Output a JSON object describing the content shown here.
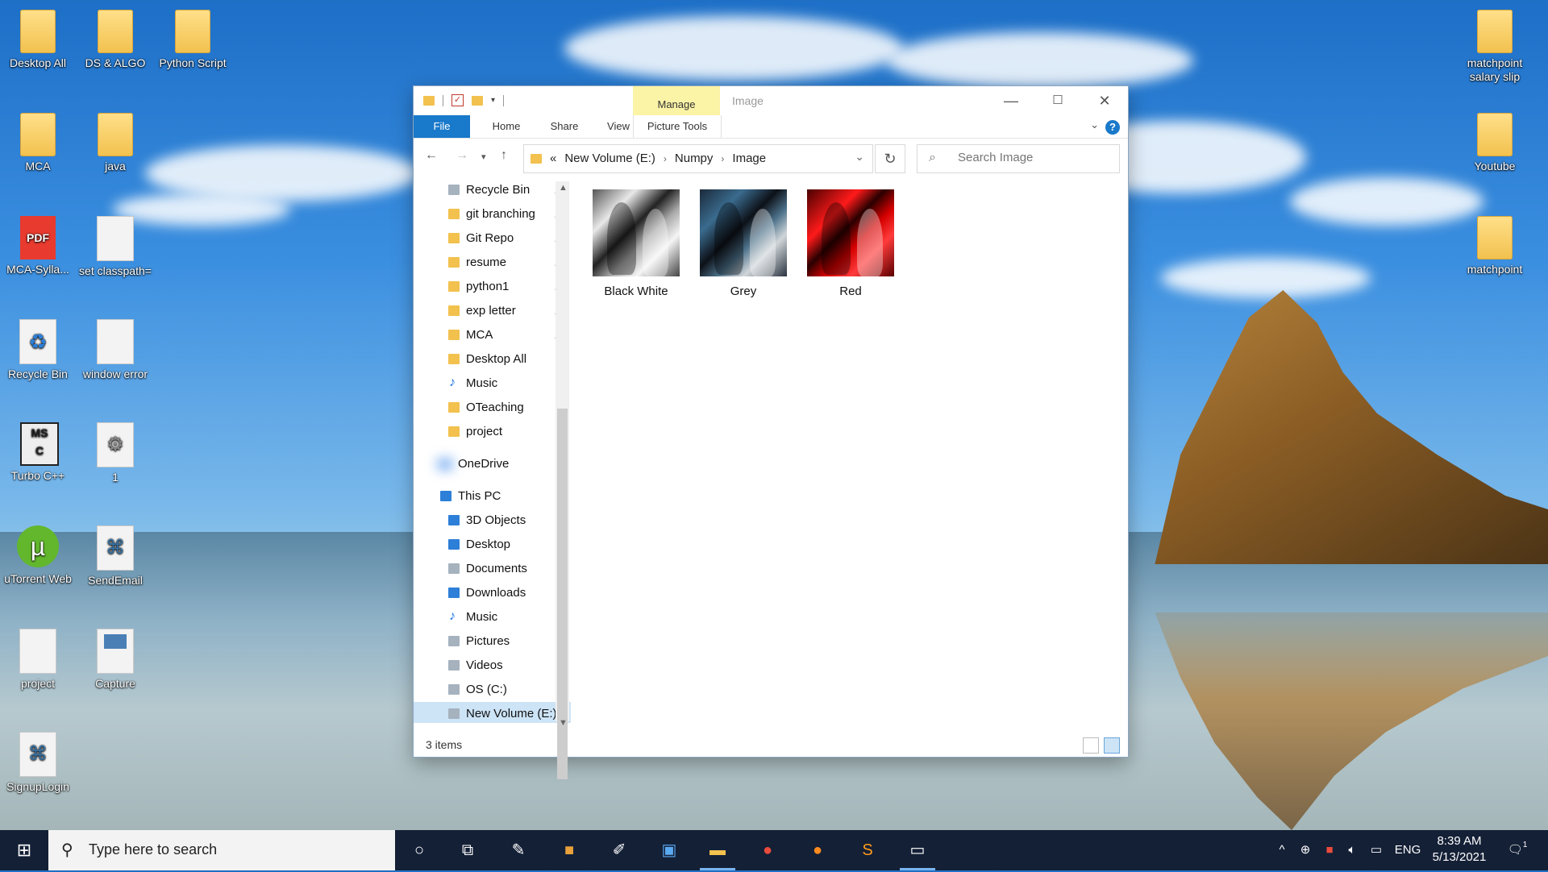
{
  "desktop": {
    "icons_left": [
      {
        "label": "Desktop All",
        "kind": "folder"
      },
      {
        "label": "DS & ALGO",
        "kind": "folder"
      },
      {
        "label": "Python Script",
        "kind": "folder"
      },
      {
        "label": "MCA",
        "kind": "folder"
      },
      {
        "label": "java",
        "kind": "folder"
      },
      {
        "label": "MCA-Sylla...",
        "kind": "pdf"
      },
      {
        "label": "set classpath=",
        "kind": "doc"
      },
      {
        "label": "Recycle Bin",
        "kind": "recycle"
      },
      {
        "label": "window error",
        "kind": "doc"
      },
      {
        "label": "Turbo C++",
        "kind": "app"
      },
      {
        "label": "1",
        "kind": "settings"
      },
      {
        "label": "uTorrent Web",
        "kind": "utorrent"
      },
      {
        "label": "SendEmail",
        "kind": "python"
      },
      {
        "label": "project",
        "kind": "doc"
      },
      {
        "label": "Capture",
        "kind": "image"
      },
      {
        "label": "SignupLogin",
        "kind": "python"
      }
    ],
    "icons_right": [
      {
        "label": "matchpoint salary slip",
        "kind": "folder"
      },
      {
        "label": "Youtube",
        "kind": "folder"
      },
      {
        "label": "matchpoint",
        "kind": "folder"
      }
    ],
    "pdf_badge": "PDF"
  },
  "explorer": {
    "title": "Image",
    "manage_tab": "Manage",
    "ribbon_tabs": [
      "File",
      "Home",
      "Share",
      "View",
      "Picture Tools"
    ],
    "breadcrumb": {
      "overflow": "«",
      "items": [
        "New Volume (E:)",
        "Numpy",
        "Image"
      ]
    },
    "search_placeholder": "Search Image",
    "nav": {
      "quick_access": [
        {
          "label": "Recycle Bin",
          "icon": "recycle-bin-icon",
          "pinned": true
        },
        {
          "label": "git branching",
          "icon": "folder-icon",
          "pinned": true
        },
        {
          "label": "Git Repo",
          "icon": "folder-icon",
          "pinned": true
        },
        {
          "label": "resume",
          "icon": "folder-icon",
          "pinned": true
        },
        {
          "label": "python1",
          "icon": "folder-icon",
          "pinned": true
        },
        {
          "label": "exp letter",
          "icon": "folder-icon",
          "pinned": true
        },
        {
          "label": "MCA",
          "icon": "folder-icon",
          "pinned": true
        },
        {
          "label": "Desktop All",
          "icon": "folder-icon",
          "pinned": false
        },
        {
          "label": "Music",
          "icon": "music-icon",
          "pinned": false
        },
        {
          "label": "OTeaching",
          "icon": "folder-icon",
          "pinned": false
        },
        {
          "label": "project",
          "icon": "folder-icon",
          "pinned": false
        }
      ],
      "onedrive": "OneDrive",
      "this_pc": "This PC",
      "pc_items": [
        {
          "label": "3D Objects",
          "icon": "3d-objects-icon"
        },
        {
          "label": "Desktop",
          "icon": "desktop-icon"
        },
        {
          "label": "Documents",
          "icon": "documents-icon"
        },
        {
          "label": "Downloads",
          "icon": "downloads-icon"
        },
        {
          "label": "Music",
          "icon": "music-icon"
        },
        {
          "label": "Pictures",
          "icon": "pictures-icon"
        },
        {
          "label": "Videos",
          "icon": "videos-icon"
        },
        {
          "label": "OS (C:)",
          "icon": "drive-icon"
        },
        {
          "label": "New Volume (E:)",
          "icon": "drive-icon",
          "selected": true
        }
      ]
    },
    "files": [
      {
        "name": "Black White",
        "style": "bw"
      },
      {
        "name": "Grey",
        "style": "grey"
      },
      {
        "name": "Red",
        "style": "red"
      }
    ],
    "status": "3 items"
  },
  "taskbar": {
    "search_placeholder": "Type here to search",
    "language": "ENG",
    "time": "8:39 AM",
    "date": "5/13/2021",
    "notification_count": "1"
  },
  "colors": {
    "accent": "#1979ca",
    "manage_tab": "#fbf3a6",
    "taskbar": "#142036",
    "selection": "#cde4f7"
  }
}
